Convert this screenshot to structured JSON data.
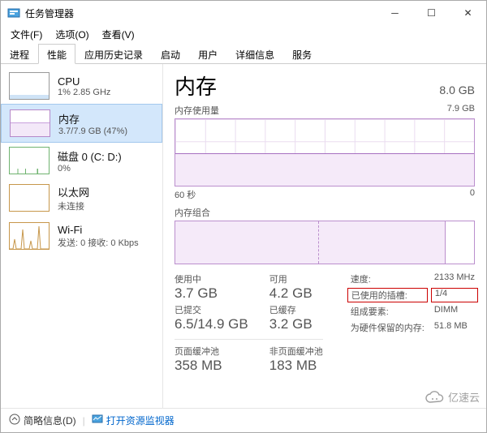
{
  "window": {
    "title": "任务管理器"
  },
  "menu": {
    "file": "文件(F)",
    "options": "选项(O)",
    "view": "查看(V)"
  },
  "tabs": [
    "进程",
    "性能",
    "应用历史记录",
    "启动",
    "用户",
    "详细信息",
    "服务"
  ],
  "active_tab_index": 1,
  "sidebar": [
    {
      "title": "CPU",
      "sub": "1% 2.85 GHz"
    },
    {
      "title": "内存",
      "sub": "3.7/7.9 GB (47%)"
    },
    {
      "title": "磁盘 0 (C: D:)",
      "sub": "0%"
    },
    {
      "title": "以太网",
      "sub": "未连接"
    },
    {
      "title": "Wi-Fi",
      "sub": "发送: 0  接收: 0 Kbps"
    }
  ],
  "main": {
    "heading": "内存",
    "capacity": "8.0 GB",
    "usage_label": "内存使用量",
    "usage_max": "7.9 GB",
    "graph_time": "60 秒",
    "graph_zero": "0",
    "composition_label": "内存组合"
  },
  "stats": {
    "in_use_label": "使用中",
    "in_use": "3.7 GB",
    "available_label": "可用",
    "available": "4.2 GB",
    "committed_label": "已提交",
    "committed": "6.5/14.9 GB",
    "cached_label": "已缓存",
    "cached": "3.2 GB",
    "paged_label": "页面缓冲池",
    "paged": "358 MB",
    "nonpaged_label": "非页面缓冲池",
    "nonpaged": "183 MB"
  },
  "right_specs": {
    "speed_label": "速度:",
    "speed": "2133 MHz",
    "slots_label": "已使用的插槽:",
    "slots": "1/4",
    "form_label": "组成要素:",
    "form": "DIMM",
    "hw_reserved_label": "为硬件保留的内存:",
    "hw_reserved": "51.8 MB"
  },
  "footer": {
    "fewer": "简略信息(D)",
    "monitor": "打开资源监视器"
  },
  "watermark": "亿速云",
  "chart_data": {
    "type": "area",
    "title": "内存使用量",
    "xlabel": "60 秒",
    "ylim": [
      0,
      7.9
    ],
    "ylabel": "GB",
    "series": [
      {
        "name": "内存",
        "values": [
          3.7,
          3.7,
          3.7,
          3.7,
          3.7,
          3.7,
          3.7,
          3.7,
          3.7,
          3.7,
          3.8,
          3.7,
          3.7,
          3.7,
          3.7,
          3.7
        ]
      }
    ]
  }
}
